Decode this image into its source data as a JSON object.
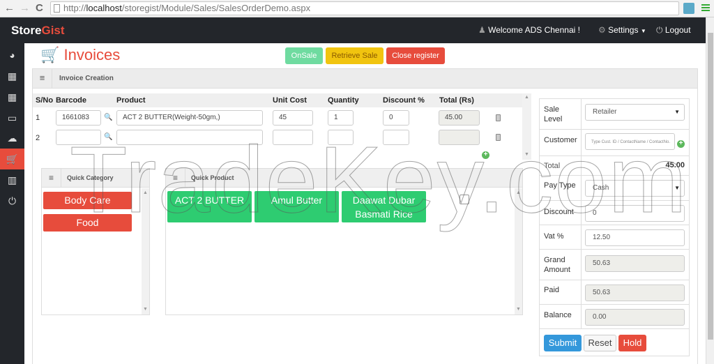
{
  "browser": {
    "url_prefix": "http://",
    "url_host": "localhost",
    "url_path": "/storegist/Module/Sales/SalesOrderDemo.aspx",
    "back_icon": "←",
    "forward_icon": "→",
    "reload_icon": "C"
  },
  "topbar": {
    "brand_a": "Store",
    "brand_b": "Gist",
    "welcome": "Welcome ADS Chennai !",
    "settings": "Settings",
    "logout": "Logout"
  },
  "sidebar": {
    "items": [
      {
        "icon": "dashboard-icon",
        "glyph": "◕"
      },
      {
        "icon": "grid-icon",
        "glyph": "▦"
      },
      {
        "icon": "grid-icon",
        "glyph": "▦"
      },
      {
        "icon": "inbox-icon",
        "glyph": "▭"
      },
      {
        "icon": "cloud-download-icon",
        "glyph": "☁"
      },
      {
        "icon": "cart-icon",
        "glyph": "🛒",
        "active": true
      },
      {
        "icon": "bar-chart-icon",
        "glyph": "▥"
      },
      {
        "icon": "power-icon",
        "glyph": "⏻"
      }
    ]
  },
  "page": {
    "title": "Invoices",
    "buttons": {
      "onsale": "OnSale",
      "retrieve": "Retrieve Sale",
      "close_register": "Close register"
    },
    "panel_title": "Invoice Creation"
  },
  "colors": {
    "accent": "#e74c3c",
    "success": "#2ecc71",
    "onsale": "#6fdba0",
    "warning": "#f1c40f",
    "primary": "#3498db",
    "dark": "#23262b"
  },
  "invoice": {
    "headers": [
      "S/No",
      "Barcode",
      "Product",
      "Unit Cost",
      "Quantity",
      "Discount %",
      "Total (Rs)"
    ],
    "rows": [
      {
        "sno": "1",
        "barcode": "1661083",
        "product": "ACT 2 BUTTER(Weight-50gm,)",
        "unit_cost": "45",
        "quantity": "1",
        "discount": "0",
        "total": "45.00"
      },
      {
        "sno": "2",
        "barcode": "",
        "product": "",
        "unit_cost": "",
        "quantity": "",
        "discount": "",
        "total": ""
      }
    ]
  },
  "quick_category": {
    "title": "Quick Category",
    "items": [
      "Body Care",
      "Food"
    ]
  },
  "quick_product": {
    "title": "Quick Product",
    "items": [
      "ACT 2 BUTTER",
      "Amul Butter",
      "Daawat Dubar Basmati Rice"
    ]
  },
  "summary": {
    "sale_level_label": "Sale Level",
    "sale_level_value": "Retailer",
    "customer_label": "Customer",
    "customer_placeholder": "Type Cust. ID / ContactName / ContactNo.",
    "total_label": "Total",
    "total_value": "45.00",
    "pay_type_label": "Pay Type",
    "pay_type_value": "Cash",
    "discount_label": "Discount",
    "discount_value": "0",
    "vat_label": "Vat %",
    "vat_value": "12.50",
    "grand_label": "Grand Amount",
    "grand_value": "50.63",
    "paid_label": "Paid",
    "paid_value": "50.63",
    "balance_label": "Balance",
    "balance_value": "0.00",
    "submit": "Submit",
    "reset": "Reset",
    "hold": "Hold"
  },
  "watermark": "TradeKey.com"
}
